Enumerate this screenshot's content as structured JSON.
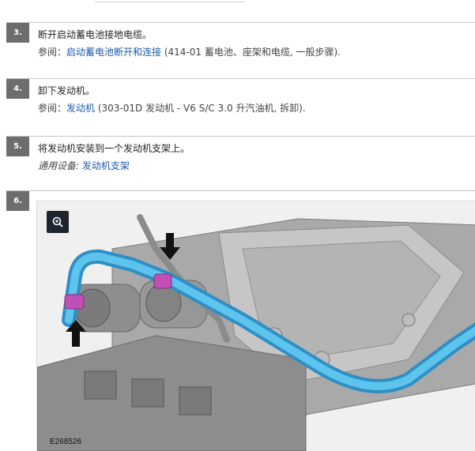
{
  "steps": [
    {
      "number": "3.",
      "title": "断开启动蓄电池接地电缆。",
      "ref_prefix": "参阅：",
      "ref_link": "启动蓄电池断开和连接",
      "ref_suffix": " (414-01 蓄电池、座架和电缆, 一般步骤)."
    },
    {
      "number": "4.",
      "title": "卸下发动机。",
      "ref_prefix": "参阅：",
      "ref_link": "发动机",
      "ref_suffix": " (303-01D 发动机 - V6 S/C 3.0 升汽油机, 拆卸)."
    },
    {
      "number": "5.",
      "title": "将发动机安装到一个发动机支架上。",
      "tool_prefix": "通用设备: ",
      "tool_link": "发动机支架"
    },
    {
      "number": "6."
    }
  ],
  "figure": {
    "label": "E268526",
    "zoom_icon": "zoom-in-icon",
    "colors": {
      "hose": "#4fb6e4",
      "clamp": "#c24fb6",
      "engine": "#9a9a9a"
    }
  }
}
